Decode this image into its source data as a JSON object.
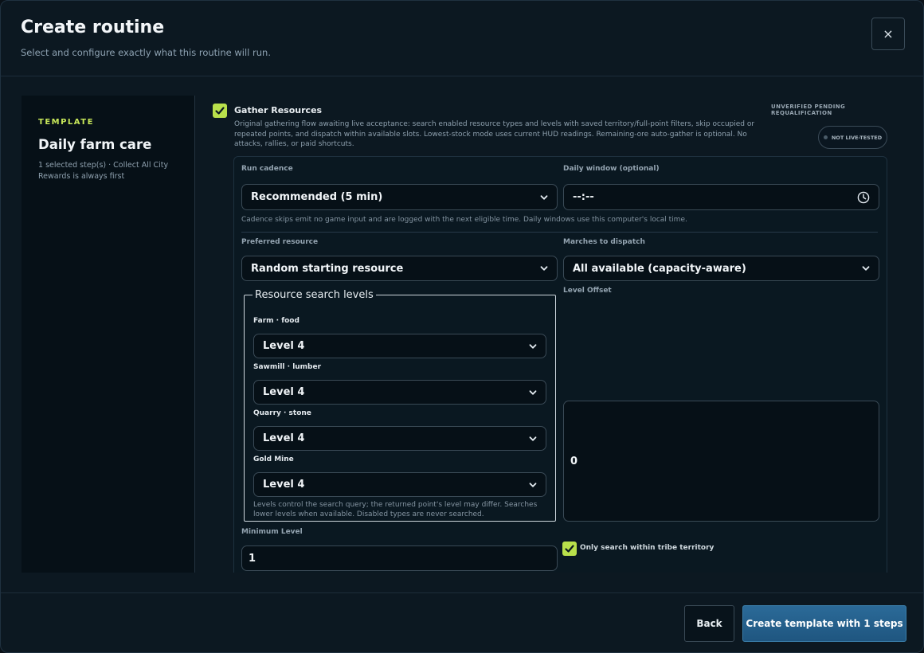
{
  "header": {
    "title": "Create routine",
    "subtitle": "Select and configure exactly what this routine will run.",
    "close_symbol": "×"
  },
  "sidebar": {
    "kicker": "TEMPLATE",
    "title": "Daily farm care",
    "meta": "1 selected step(s) · Collect All City Rewards is always first"
  },
  "step": {
    "checked": true,
    "title": "Gather Resources",
    "description": "Original gathering flow awaiting live acceptance: search enabled resource types and levels with saved territory/full-point filters, skip occupied or repeated points, and dispatch within available slots. Lowest-stock mode uses current HUD readings. Remaining-ore auto-gather is optional. No attacks, rallies, or paid shortcuts.",
    "status": "UNVERIFIED PENDING REQUALIFICATION",
    "badge": "NOT LIVE-TESTED"
  },
  "config": {
    "run_cadence": {
      "label": "Run cadence",
      "value": "Recommended (5 min)"
    },
    "daily_window": {
      "label": "Daily window (optional)",
      "value": "--:--"
    },
    "cadence_note": "Cadence skips emit no game input and are logged with the next eligible time. Daily windows use this computer's local time.",
    "preferred_resource": {
      "label": "Preferred resource",
      "value": "Random starting resource"
    },
    "marches": {
      "label": "Marches to dispatch",
      "value": "All available (capacity-aware)"
    },
    "levels": {
      "legend": "Resource search levels",
      "items": [
        {
          "label": "Farm · food",
          "value": "Level 4"
        },
        {
          "label": "Sawmill · lumber",
          "value": "Level 4"
        },
        {
          "label": "Quarry · stone",
          "value": "Level 4"
        },
        {
          "label": "Gold Mine",
          "value": "Level 4"
        }
      ],
      "note": "Levels control the search query; the returned point's level may differ. Searches lower levels when available. Disabled types are never searched."
    },
    "level_offset": {
      "label": "Level Offset",
      "value": "0"
    },
    "minimum_level": {
      "label": "Minimum Level",
      "value": "1"
    },
    "tribe_territory": {
      "checked": true,
      "label": "Only search within tribe territory"
    }
  },
  "footer": {
    "back_label": "Back",
    "create_label": "Create template with 1 steps"
  },
  "colors": {
    "accent_lime": "#b9e04b",
    "primary_blue": "#2b6a98",
    "background": "#0c1821"
  }
}
